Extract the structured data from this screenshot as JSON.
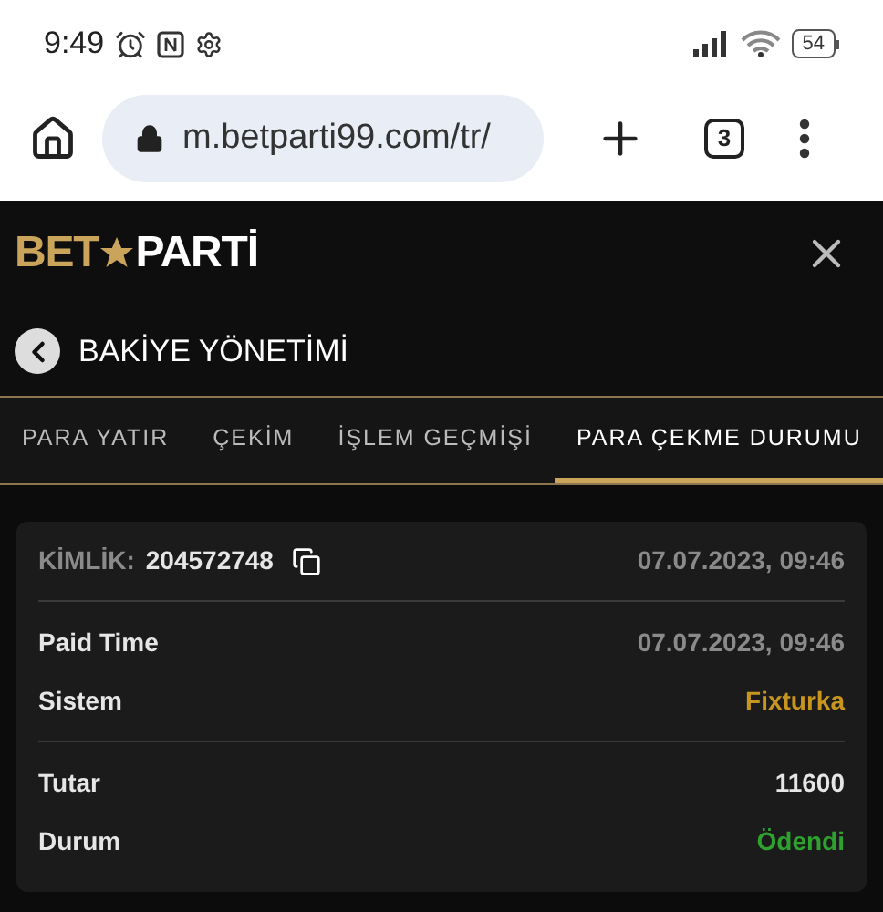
{
  "status_bar": {
    "time": "9:49",
    "battery": "54"
  },
  "browser": {
    "url": "m.betparti99.com/tr/",
    "tab_count": "3"
  },
  "logo": {
    "left": "BET",
    "right": "PARTİ"
  },
  "section": {
    "title": "BAKİYE YÖNETİMİ"
  },
  "tabs": [
    {
      "label": "PARA YATIR",
      "selected": false
    },
    {
      "label": "ÇEKİM",
      "selected": false
    },
    {
      "label": "İŞLEM GEÇMİŞİ",
      "selected": false
    },
    {
      "label": "PARA ÇEKME DURUMU",
      "selected": true
    }
  ],
  "card": {
    "id_label": "KİMLİK:",
    "id_value": "204572748",
    "date": "07.07.2023, 09:46",
    "groups": [
      [
        {
          "label": "Paid Time",
          "value": "07.07.2023, 09:46",
          "color": "#8a8a8a"
        },
        {
          "label": "Sistem",
          "value": "Fixturka",
          "color": "#c8961e"
        }
      ],
      [
        {
          "label": "Tutar",
          "value": "11600",
          "color": "#e6e6e6"
        },
        {
          "label": "Durum",
          "value": "Ödendi",
          "color": "#2ea12e"
        }
      ]
    ]
  }
}
